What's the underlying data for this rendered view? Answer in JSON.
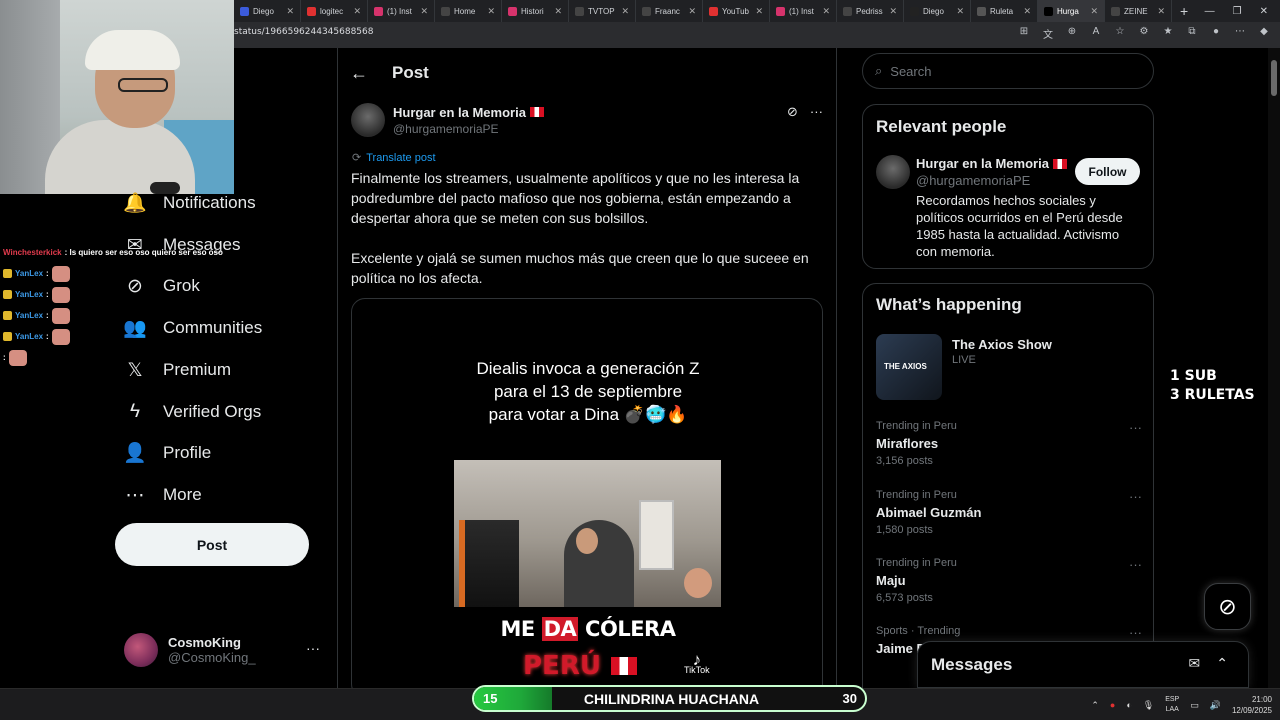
{
  "browser": {
    "tabs": [
      {
        "label": "Diego",
        "color": "#3b5bdb"
      },
      {
        "label": "logitec",
        "color": "#e03131"
      },
      {
        "label": "(1) Inst",
        "color": "#d6336c"
      },
      {
        "label": "Home",
        "color": "#444"
      },
      {
        "label": "Histori",
        "color": "#d6336c"
      },
      {
        "label": "TVTOP",
        "color": "#444"
      },
      {
        "label": "Fraanc",
        "color": "#444"
      },
      {
        "label": "YouTub",
        "color": "#e03131"
      },
      {
        "label": "(1) Inst",
        "color": "#d6336c"
      },
      {
        "label": "Pedriss",
        "color": "#444"
      },
      {
        "label": "Diego",
        "color": "#222"
      },
      {
        "label": "Ruleta",
        "color": "#555"
      },
      {
        "label": "Hurga",
        "color": "#000",
        "active": true
      },
      {
        "label": "ZEINE",
        "color": "#444"
      }
    ],
    "url": "status/1966596244345688568"
  },
  "nav": {
    "items": [
      {
        "label": "Notifications",
        "icon": "bell-icon",
        "glyph": "🔔"
      },
      {
        "label": "Messages",
        "icon": "envelope-icon",
        "glyph": "✉"
      },
      {
        "label": "Grok",
        "icon": "grok-icon",
        "glyph": "⊘"
      },
      {
        "label": "Communities",
        "icon": "communities-icon",
        "glyph": "👥"
      },
      {
        "label": "Premium",
        "icon": "x-logo-icon",
        "glyph": "𝕏"
      },
      {
        "label": "Verified Orgs",
        "icon": "lightning-icon",
        "glyph": "ϟ"
      },
      {
        "label": "Profile",
        "icon": "person-icon",
        "glyph": "👤"
      },
      {
        "label": "More",
        "icon": "more-circle-icon",
        "glyph": "⋯"
      }
    ],
    "post_button": "Post",
    "account": {
      "name": "CosmoKing",
      "handle": "@CosmoKing_"
    }
  },
  "chat": [
    {
      "user": "Winchesterkick",
      "msg": ": Is quiero ser eso oso quiero ser eso oso",
      "color": "#e23b4d",
      "emote": false
    },
    {
      "user": "YanLex",
      "msg": ":",
      "color": "#3d9ae8",
      "emote": true
    },
    {
      "user": "YanLex",
      "msg": ":",
      "color": "#3d9ae8",
      "emote": true
    },
    {
      "user": "YanLex",
      "msg": ":",
      "color": "#3d9ae8",
      "emote": true
    },
    {
      "user": "YanLex",
      "msg": ":",
      "color": "#3d9ae8",
      "emote": true
    },
    {
      "user": "",
      "msg": ":",
      "color": "#fff",
      "emote": true
    }
  ],
  "post": {
    "header": "Post",
    "author_name": "Hurgar en la Memoria",
    "author_handle": "@hurgamemoriaPE",
    "translate": "Translate post",
    "paragraphs": [
      "Finalmente los streamers, usualmente apolíticos y que no les interesa la podredumbre del pacto mafioso que nos gobierna, están empezando a despertar ahora que se meten con sus bolsillos.",
      "Excelente y ojalá se sumen muchos más que creen que lo que suceee en política no los afecta."
    ],
    "media": {
      "caption_lines": [
        "Diealis invoca a generación Z",
        "para el 13 de septiembre",
        "para votar a Dina 💣🥶🔥"
      ],
      "me": "ME ",
      "da": "DA",
      "colera": " CÓLERA",
      "peru": "PERÚ",
      "tiktok": "TikTok"
    }
  },
  "sidebar": {
    "search_placeholder": "Search",
    "relevant": {
      "title": "Relevant people",
      "name": "Hurgar en la Memoria",
      "handle": "@hurgamemoriaPE",
      "follow": "Follow",
      "bio": "Recordamos hechos sociales y políticos ocurridos en el Perú desde 1985 hasta la actualidad. Activismo con memoria."
    },
    "happening": {
      "title": "What’s happening",
      "live_title": "The Axios Show",
      "live_badge": "LIVE",
      "thumb_text": "THE AXIOS",
      "trends": [
        {
          "context": "Trending in Peru",
          "title": "Miraflores",
          "count": "3,156 posts"
        },
        {
          "context": "Trending in Peru",
          "title": "Abimael Guzmán",
          "count": "1,580 posts"
        },
        {
          "context": "Trending in Peru",
          "title": "Maju",
          "count": "6,573 posts"
        },
        {
          "context": "Sports · Trending",
          "title": "Jaime F",
          "count": ""
        }
      ]
    },
    "messages": "Messages"
  },
  "promo": {
    "line1": "1 SUB",
    "line2": "3 RULETAS"
  },
  "progress": {
    "level": "15",
    "name": "CHILINDRINA HUACHANA",
    "max": "30",
    "fill_fraction": 0.2
  },
  "tray": {
    "lang1": "ESP",
    "lang2": "LAA",
    "time": "21:00",
    "date": "12/09/2025"
  },
  "colors": {
    "accent": "#1d9bf0",
    "bg": "#000000",
    "border": "#2f3336",
    "muted": "#71767b"
  }
}
